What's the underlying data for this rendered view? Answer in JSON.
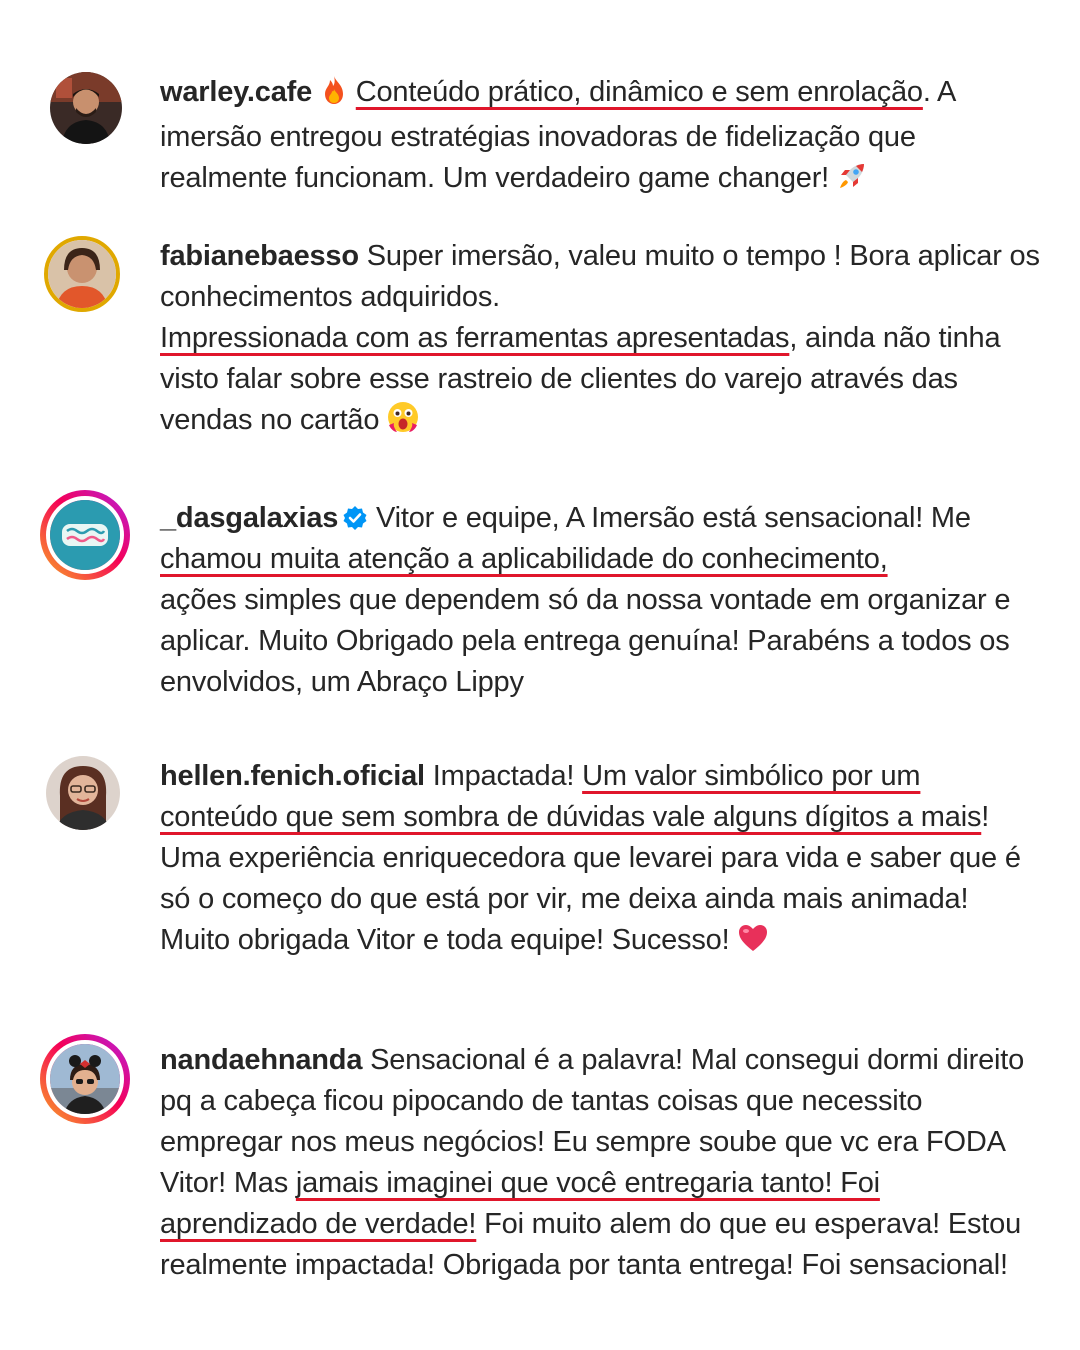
{
  "comments": [
    {
      "username": "warley.cafe",
      "emoji_after_user": "fire",
      "before": "",
      "highlight": "Conteúdo prático, dinâmico e sem enrolação",
      "after": ". A imersão  entregou estratégias  inovadoras de fidelização que realmente funcionam. Um verdadeiro game changer!",
      "trailing_emoji": "rocket"
    },
    {
      "username": "fabianebaesso",
      "before": "Super imersão, valeu muito o tempo ! Bora aplicar os conhecimentos adquiridos.",
      "highlight": "Impressionada com as ferramentas apresentadas",
      "after": ", ainda não tinha visto falar sobre esse rastreio de clientes do varejo através das vendas no cartão",
      "trailing_emoji": "astonished-face"
    },
    {
      "username": "_dasgalaxias",
      "verified": true,
      "before": "Vitor e equipe, A Imersão está sensacional! Me",
      "highlight": "chamou muita atenção a aplicabilidade do conhecimento,",
      "after": "ações simples que dependem só da nossa vontade em organizar e aplicar. Muito Obrigado pela entrega genuína! Parabéns a todos os envolvidos, um Abraço Lippy",
      "trailing_emoji": ""
    },
    {
      "username": "hellen.fenich.oficial",
      "before": "Impactada!",
      "highlight": "Um valor simbólico por um conteúdo que  sem sombra de dúvidas vale alguns dígitos a mais",
      "after": "! Uma experiência enriquecedora que levarei para vida e saber que é  só o começo do que está por vir, me deixa ainda mais animada! Muito obrigada Vitor e toda equipe! Sucesso!",
      "trailing_emoji": "heart"
    },
    {
      "username": "nandaehnanda",
      "before": "Sensacional é a palavra! Mal consegui dormi direito pq a cabeça ficou pipocando de tantas coisas que necessito empregar nos meus negócios! Eu sempre soube que vc era FODA Vitor! Mas",
      "highlight": "jamais imaginei que você entregaria tanto! Foi aprendizado de verdade!",
      "after": "Foi muito alem do que eu esperava! Estou realmente impactada! Obrigada por tanta entrega! Foi sensacional!",
      "trailing_emoji": ""
    }
  ],
  "colors": {
    "text": "#262626",
    "highlight_underline": "#e0162b",
    "verified_badge": "#0095f6",
    "story_ring_start": "#f9a825",
    "story_ring_end": "#b620e0"
  }
}
